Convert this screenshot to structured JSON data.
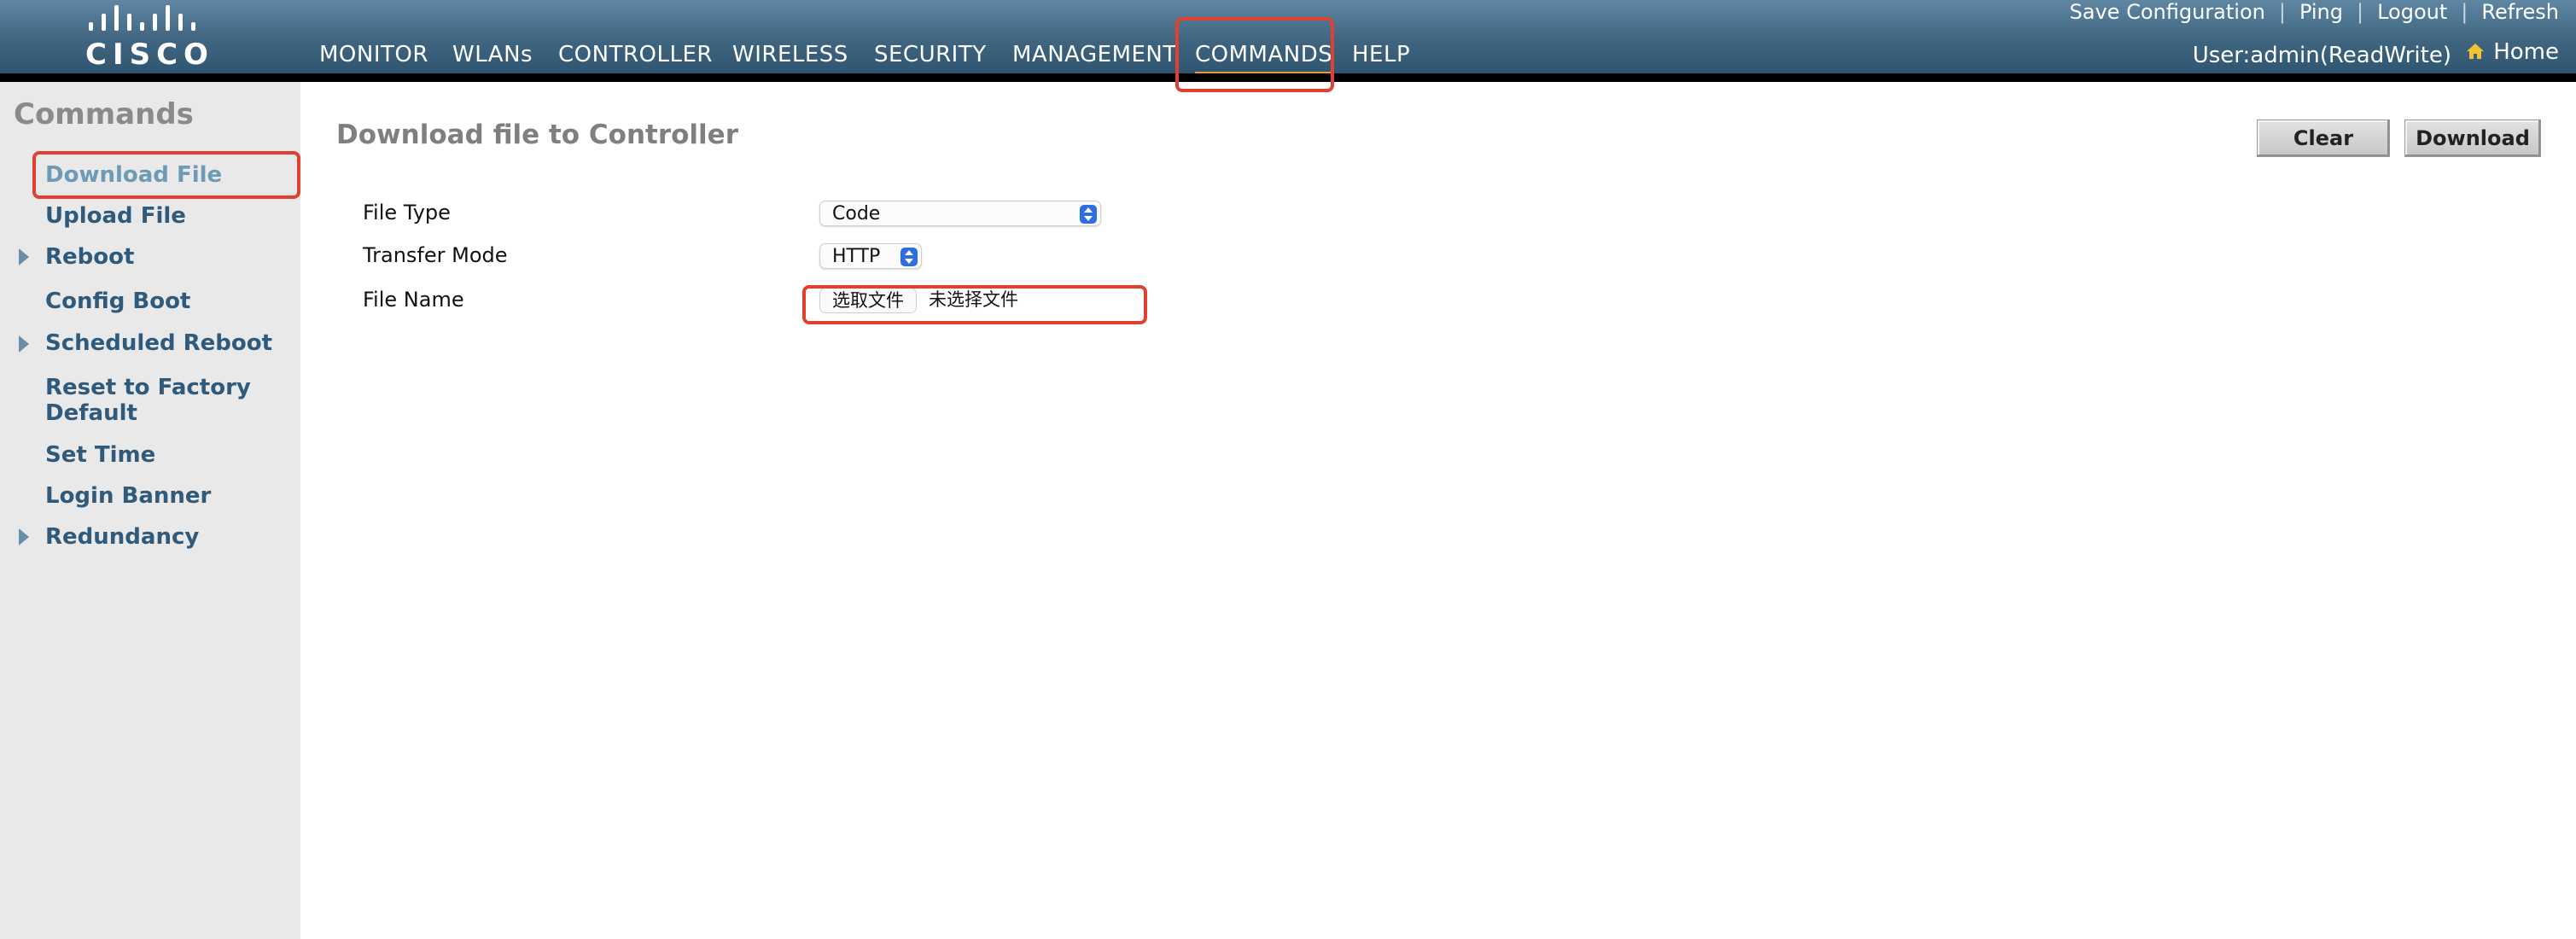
{
  "brand": {
    "logo_text": "CISCO"
  },
  "top_links": {
    "save_configuration": "Save Configuration",
    "ping": "Ping",
    "logout": "Logout",
    "refresh": "Refresh"
  },
  "user": {
    "info": "User:admin(ReadWrite)",
    "home_label": "Home"
  },
  "nav": {
    "items": [
      {
        "label": "MONITOR"
      },
      {
        "label": "WLANs"
      },
      {
        "label": "CONTROLLER"
      },
      {
        "label": "WIRELESS"
      },
      {
        "label": "SECURITY"
      },
      {
        "label": "MANAGEMENT"
      },
      {
        "label": "COMMANDS",
        "active": true
      },
      {
        "label": "HELP"
      }
    ]
  },
  "sidebar": {
    "title": "Commands",
    "items": [
      {
        "label": "Download File",
        "active": true
      },
      {
        "label": "Upload File"
      },
      {
        "label": "Reboot",
        "expandable": true
      },
      {
        "label": "Config Boot"
      },
      {
        "label": "Scheduled Reboot",
        "expandable": true
      },
      {
        "label": "Reset to Factory",
        "label_line2": "Default"
      },
      {
        "label": "Set Time"
      },
      {
        "label": "Login Banner"
      },
      {
        "label": "Redundancy",
        "expandable": true
      }
    ]
  },
  "main": {
    "title": "Download file to Controller",
    "buttons": {
      "clear": "Clear",
      "download": "Download"
    },
    "form": {
      "file_type": {
        "label": "File Type",
        "value": "Code"
      },
      "transfer_mode": {
        "label": "Transfer Mode",
        "value": "HTTP"
      },
      "file_name": {
        "label": "File Name",
        "button_label": "选取文件",
        "status": "未选择文件"
      }
    }
  },
  "colors": {
    "accent": "#e89a3c",
    "highlight": "#e0402f",
    "sidebar_link": "#2f5a7c",
    "header": "#3f6580"
  }
}
